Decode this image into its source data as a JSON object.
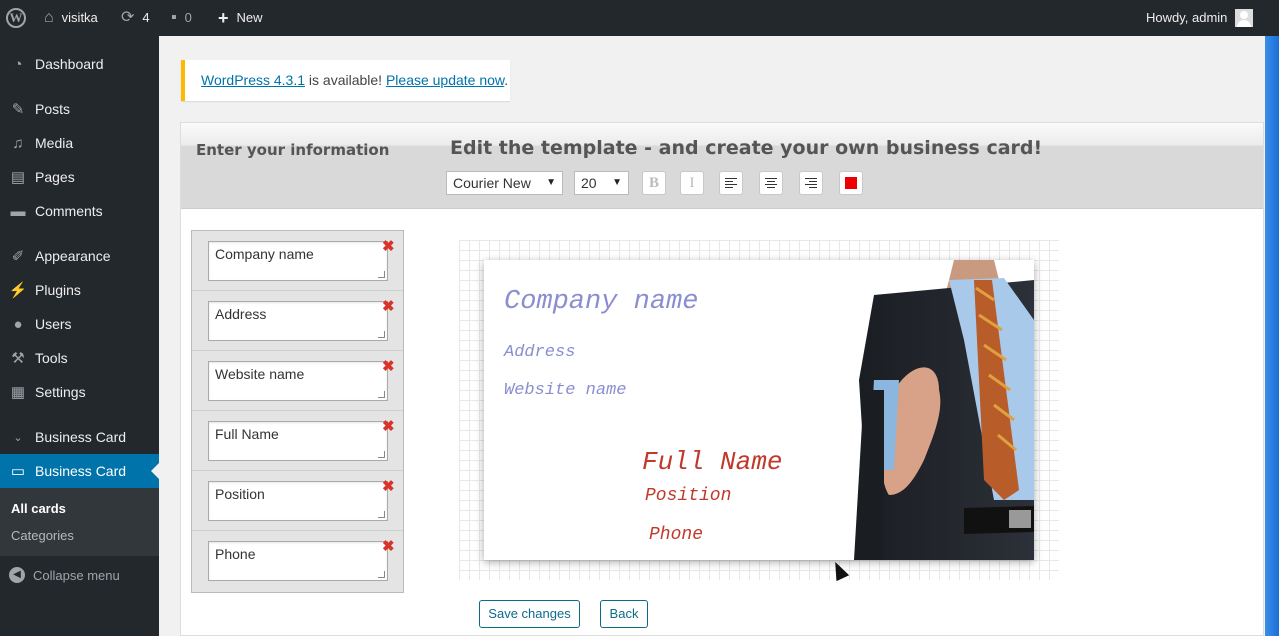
{
  "adminbar": {
    "site_name": "visitka",
    "updates_count": "4",
    "comments_count": "0",
    "new_label": "New",
    "howdy": "Howdy, admin"
  },
  "sidebar": {
    "items": [
      {
        "label": "Dashboard",
        "icon": "dashboard-icon"
      },
      {
        "label": "Posts",
        "icon": "pin-icon"
      },
      {
        "label": "Media",
        "icon": "media-icon"
      },
      {
        "label": "Pages",
        "icon": "pages-icon"
      },
      {
        "label": "Comments",
        "icon": "comment-icon"
      },
      {
        "label": "Appearance",
        "icon": "brush-icon"
      },
      {
        "label": "Plugins",
        "icon": "plug-icon"
      },
      {
        "label": "Users",
        "icon": "user-icon"
      },
      {
        "label": "Tools",
        "icon": "wrench-icon"
      },
      {
        "label": "Settings",
        "icon": "settings-icon"
      },
      {
        "label": "Business Card",
        "icon": "card-icon"
      },
      {
        "label": "Business Card",
        "icon": "id-card-icon"
      }
    ],
    "submenu": [
      "All cards",
      "Categories"
    ],
    "collapse_label": "Collapse menu"
  },
  "notice": {
    "link1": "WordPress 4.3.1",
    "middle": " is available! ",
    "link2": "Please update now",
    "end": "."
  },
  "editor": {
    "left_title": "Enter your information",
    "main_title": "Edit the template - and create your own business card!",
    "font_family": "Courier New",
    "font_size": "20",
    "bold_label": "B",
    "italic_label": "I",
    "text_color": "#e00000"
  },
  "fields": [
    "Company name",
    "Address",
    "Website name",
    "Full Name",
    "Position",
    "Phone"
  ],
  "card": {
    "company": "Company name",
    "address": "Address",
    "website": "Website name",
    "full_name": "Full Name",
    "position": "Position",
    "phone": "Phone",
    "blue_color": "#8a8ed0",
    "red_color": "#c0392b"
  },
  "buttons": {
    "save": "Save changes",
    "back": "Back"
  }
}
